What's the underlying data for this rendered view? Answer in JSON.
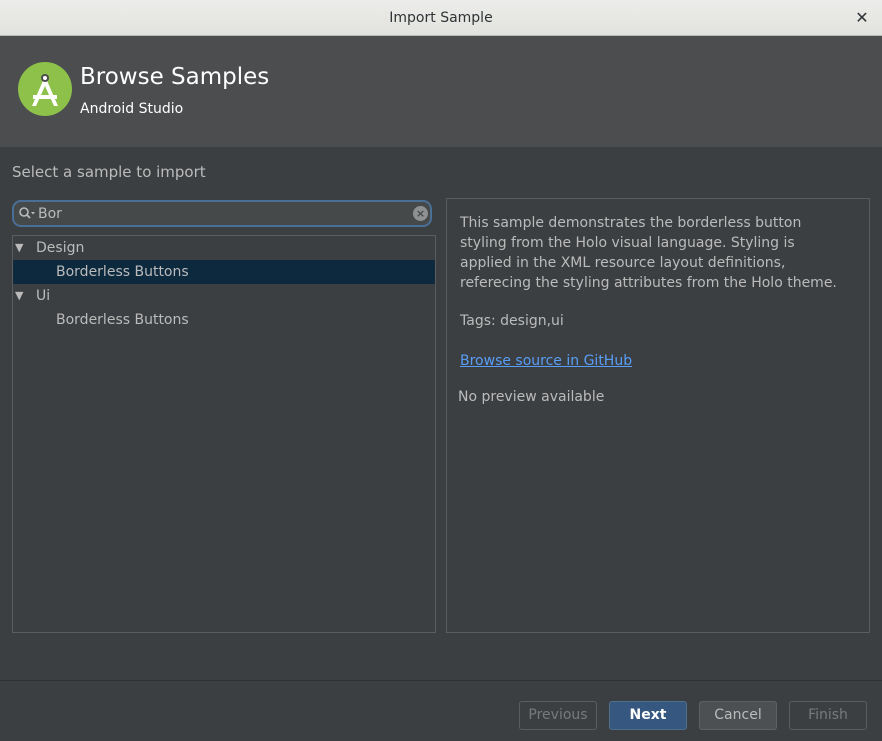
{
  "window": {
    "title": "Import Sample",
    "close_glyph": "✕"
  },
  "header": {
    "logo_icon": "android-studio-icon",
    "title": "Browse Samples",
    "subtitle": "Android Studio"
  },
  "main": {
    "section_label": "Select a sample to import",
    "search": {
      "value": "Bor",
      "search_icon": "search-icon",
      "clear_icon": "clear-icon",
      "clear_glyph": "×"
    },
    "tree": [
      {
        "label": "Design",
        "expanded": true,
        "arrow": "▼"
      },
      {
        "label": "Borderless Buttons",
        "selected": true
      },
      {
        "label": "Ui",
        "expanded": true,
        "arrow": "▼"
      },
      {
        "label": "Borderless Buttons",
        "selected": false
      }
    ],
    "details": {
      "description": "This sample demonstrates the borderless button styling from the Holo visual language. Styling is applied in the XML resource layout definitions, referecing the styling attributes from the Holo theme.",
      "tags": "Tags: design,ui",
      "link": "Browse source in GitHub",
      "no_preview": "No preview available"
    }
  },
  "footer": {
    "previous": "Previous",
    "next": "Next",
    "cancel": "Cancel",
    "finish": "Finish"
  },
  "colors": {
    "accent": "#365880",
    "selection": "#0d293e",
    "link": "#589df6",
    "logo_green": "#8dc149"
  }
}
